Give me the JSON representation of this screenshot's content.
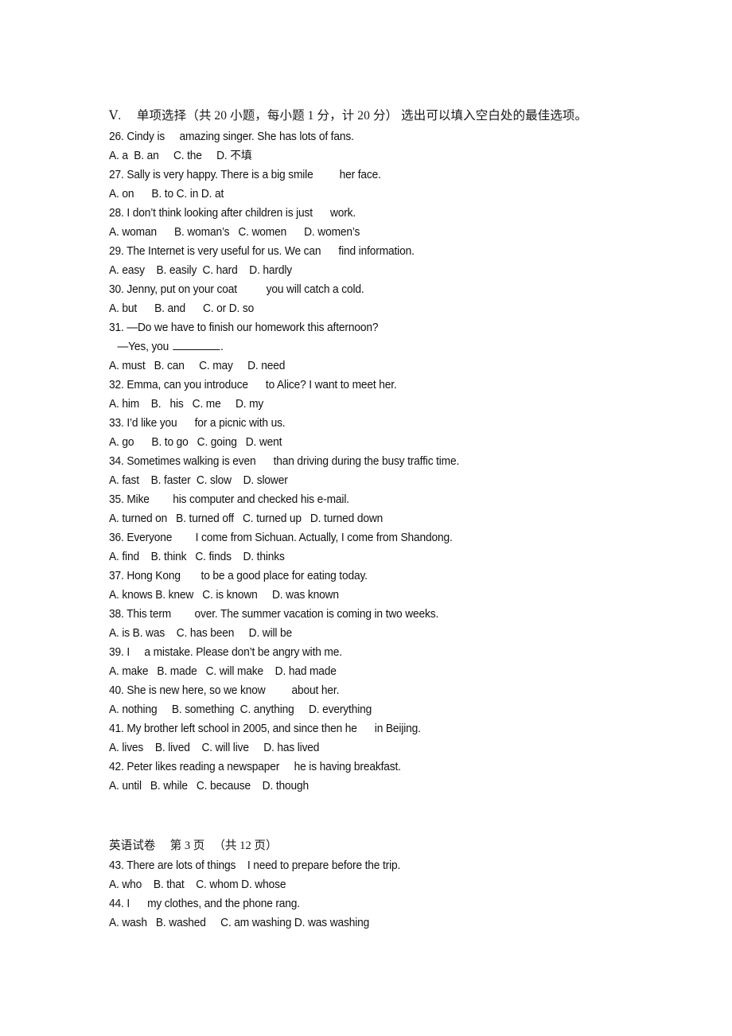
{
  "document": {
    "kind": "exam-paper",
    "language": "zh-en",
    "page_marker": "英语试卷　 第 3 页 　（共 12 页）"
  },
  "section": {
    "heading": "Ⅴ.　 单项选择（共 20 小题，每小题 1 分，计 20 分） 选出可以填入空白处的最佳选项。"
  },
  "questions": [
    {
      "number": "26",
      "stem": "26. Cindy is     amazing singer. She has lots of fans.",
      "options": "A. a  B. an     C. the     D. 不填"
    },
    {
      "number": "27",
      "stem": "27. Sally is very happy. There is a big smile         her face.",
      "options": "A. on      B. to C. in D. at"
    },
    {
      "number": "28",
      "stem": "28. I don’t think looking after children is just      work.",
      "options": "A. woman      B. woman’s   C. women      D. women’s"
    },
    {
      "number": "29",
      "stem": "29. The Internet is very useful for us. We can      find information.",
      "options": "A. easy    B. easily  C. hard    D. hardly"
    },
    {
      "number": "30",
      "stem": "30. Jenny, put on your coat          you will catch a cold.",
      "options": "A. but      B. and      C. or D. so"
    },
    {
      "number": "31",
      "stem": "31. —Do we have to finish our homework this afternoon?",
      "stem_line2_prefix": "—Yes, you ",
      "stem_line2_suffix": ".",
      "options": "A. must   B. can     C. may     D. need"
    },
    {
      "number": "32",
      "stem": "32. Emma, can you introduce      to Alice? I want to meet her.",
      "options": "A. him    B.   his   C. me     D. my"
    },
    {
      "number": "33",
      "stem": "33. I’d like you      for a picnic with us.",
      "options": "A. go      B. to go   C. going   D. went"
    },
    {
      "number": "34",
      "stem": "34. Sometimes walking is even      than driving during the busy traffic time.",
      "options": "A. fast    B. faster  C. slow    D. slower"
    },
    {
      "number": "35",
      "stem": "35. Mike        his computer and checked his e-mail.",
      "options": "A. turned on   B. turned off   C. turned up   D. turned down"
    },
    {
      "number": "36",
      "stem": "36. Everyone        I come from Sichuan. Actually, I come from Shandong.",
      "options": "A. find    B. think   C. finds    D. thinks"
    },
    {
      "number": "37",
      "stem": "37. Hong Kong       to be a good place for eating today.",
      "options": "A. knows B. knew   C. is known     D. was known"
    },
    {
      "number": "38",
      "stem": "38. This term        over. The summer vacation is coming in two weeks.",
      "options": "A. is B. was    C. has been     D. will be"
    },
    {
      "number": "39",
      "stem": "39. I     a mistake. Please don’t be angry with me.",
      "options": "A. make   B. made   C. will make    D. had made"
    },
    {
      "number": "40",
      "stem": "40. She is new here, so we know         about her.",
      "options": "A. nothing     B. something  C. anything     D. everything"
    },
    {
      "number": "41",
      "stem": "41. My brother left school in 2005, and since then he      in Beijing.",
      "options": "A. lives    B. lived    C. will live     D. has lived"
    },
    {
      "number": "42",
      "stem": "42. Peter likes reading a newspaper     he is having breakfast.",
      "options": "A. until   B. while   C. because    D. though"
    },
    {
      "number": "43",
      "stem": "43. There are lots of things    I need to prepare before the trip.",
      "options": "A. who    B. that    C. whom D. whose"
    },
    {
      "number": "44",
      "stem": "44. I      my clothes, and the phone rang.",
      "options": "A. wash   B. washed     C. am washing D. was washing"
    }
  ]
}
